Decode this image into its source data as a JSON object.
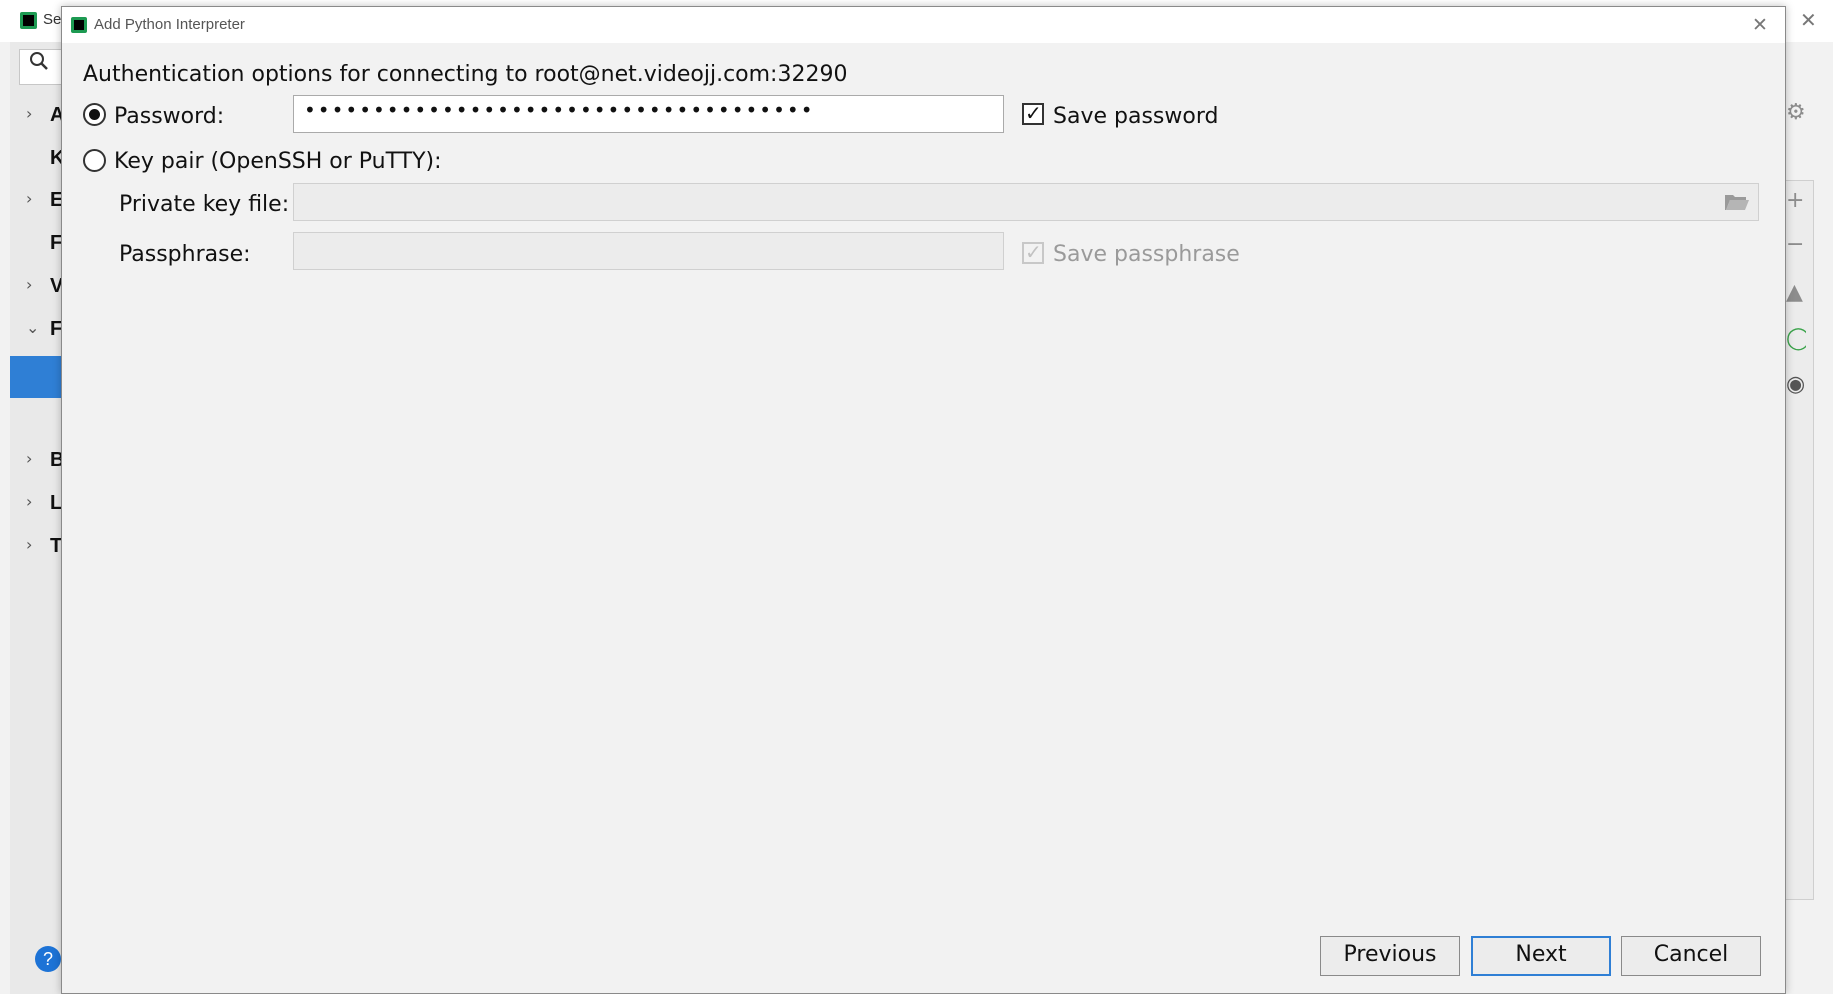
{
  "background_window": {
    "title_fragment": "Se",
    "tree_letters": [
      "A",
      "K",
      "E",
      "F",
      "V",
      "F",
      "B",
      "L",
      "T"
    ],
    "help_label": "?"
  },
  "dialog": {
    "title": "Add Python Interpreter",
    "heading": "Authentication options for connecting to root@net.videojj.com:32290",
    "password_option": {
      "label": "Password:",
      "selected": true,
      "value": "•••••••••••••••••••••••••••••••••••••",
      "save_label": "Save password",
      "save_checked": true
    },
    "keypair_option": {
      "label": "Key pair (OpenSSH or PuTTY):",
      "selected": false,
      "private_key_label": "Private key file:",
      "private_key_value": "",
      "passphrase_label": "Passphrase:",
      "passphrase_value": "",
      "save_passphrase_label": "Save passphrase",
      "save_passphrase_checked": true,
      "save_passphrase_disabled": true
    },
    "buttons": {
      "previous": "Previous",
      "next": "Next",
      "cancel": "Cancel"
    },
    "icons": {
      "dialog_icon": "pycharm-icon",
      "close": "close-icon",
      "browse": "folder-icon"
    },
    "colors": {
      "accent": "#2f7fd5",
      "selection": "#2f7fd5"
    }
  }
}
